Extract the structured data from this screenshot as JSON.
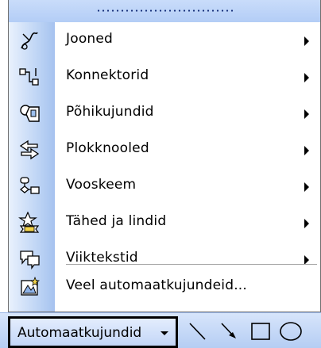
{
  "menu": {
    "items": [
      {
        "label": "Jooned",
        "icon": "lines-icon",
        "has_submenu": true
      },
      {
        "label": "Konnektorid",
        "icon": "connectors-icon",
        "has_submenu": true
      },
      {
        "label": "Põhikujundid",
        "icon": "basic-shapes-icon",
        "has_submenu": true
      },
      {
        "label": "Plokknooled",
        "icon": "block-arrows-icon",
        "has_submenu": true
      },
      {
        "label": "Vooskeem",
        "icon": "flowchart-icon",
        "has_submenu": true
      },
      {
        "label": "Tähed ja lindid",
        "icon": "stars-banners-icon",
        "has_submenu": true
      },
      {
        "label": "Viiktekstid",
        "icon": "callouts-icon",
        "has_submenu": true
      },
      {
        "label": "Veel automaatkujundeid...",
        "icon": "more-autoshapes-icon",
        "has_submenu": false
      }
    ]
  },
  "toolbar": {
    "autoshapes_label": "Automaatkujundid",
    "tools": [
      "line-tool-icon",
      "arrow-tool-icon",
      "rectangle-tool-icon",
      "oval-tool-icon"
    ]
  },
  "colors": {
    "menu_gradient_light": "#e9f1fd",
    "menu_gradient_dark": "#a6c2ef",
    "toolbar_light": "#d7e5fb",
    "toolbar_dark": "#b5cdf3",
    "grip_dots": "#16307a"
  }
}
